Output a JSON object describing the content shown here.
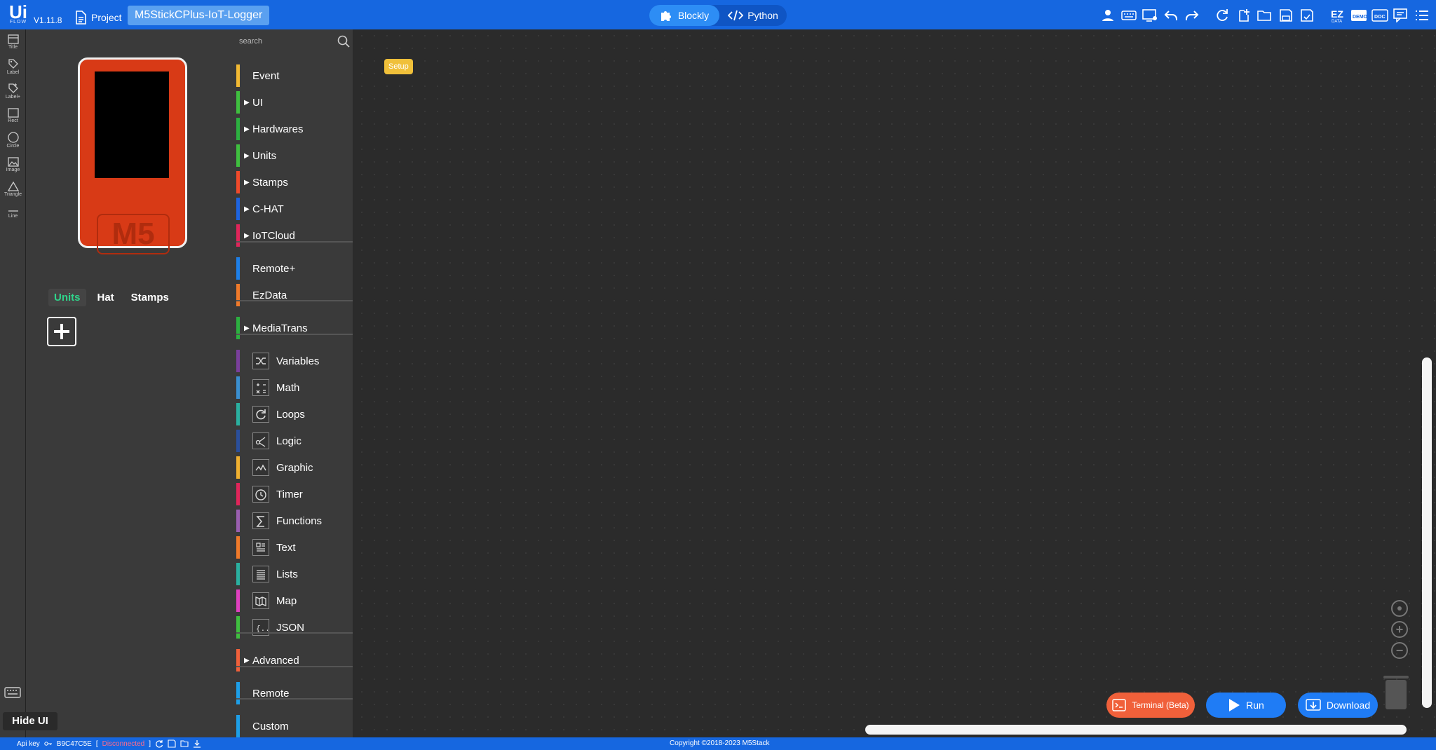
{
  "app": {
    "logo": "Ui",
    "logo_sub": "FLOW",
    "version": "V1.11.8",
    "project_label": "Project",
    "project_name": "M5StickCPlus-IoT-Logger"
  },
  "mode": {
    "blockly": "Blockly",
    "python": "Python"
  },
  "tools": [
    {
      "label": "Title",
      "icon": "title-icon"
    },
    {
      "label": "Label",
      "icon": "label-icon"
    },
    {
      "label": "Label+",
      "icon": "label-plus-icon"
    },
    {
      "label": "Rect",
      "icon": "rect-icon"
    },
    {
      "label": "Circle",
      "icon": "circle-icon"
    },
    {
      "label": "Image",
      "icon": "image-icon"
    },
    {
      "label": "Triangle",
      "icon": "triangle-icon"
    },
    {
      "label": "Line",
      "icon": "line-icon"
    }
  ],
  "device": {
    "logo_text": "M5"
  },
  "panel_tabs": [
    "Units",
    "Hat",
    "Stamps"
  ],
  "hide_ui": "Hide UI",
  "toolbox": {
    "search_placeholder": "search",
    "categories": [
      {
        "label": "Event",
        "color": "#f2b933",
        "arrow": false
      },
      {
        "label": "UI",
        "color": "#3fbf3f",
        "arrow": true
      },
      {
        "label": "Hardwares",
        "color": "#2cb040",
        "arrow": true
      },
      {
        "label": "Units",
        "color": "#3fbf3f",
        "arrow": true
      },
      {
        "label": "Stamps",
        "color": "#f04a2a",
        "arrow": true
      },
      {
        "label": "C-HAT",
        "color": "#1d64e0",
        "arrow": true
      },
      {
        "label": "IoTCloud",
        "color": "#e0255a",
        "arrow": true
      },
      {
        "label": "Remote+",
        "color": "#1d7fe8",
        "arrow": false
      },
      {
        "label": "EzData",
        "color": "#f07a2a",
        "arrow": false
      },
      {
        "label": "MediaTrans",
        "color": "#2cb040",
        "arrow": true
      },
      {
        "label": "Variables",
        "color": "#7a3f9c",
        "icon": "variables-icon"
      },
      {
        "label": "Math",
        "color": "#3a8fd0",
        "icon": "math-icon"
      },
      {
        "label": "Loops",
        "color": "#2ab0a0",
        "icon": "loops-icon"
      },
      {
        "label": "Logic",
        "color": "#2a4f9c",
        "icon": "logic-icon"
      },
      {
        "label": "Graphic",
        "color": "#f0b030",
        "icon": "graphic-icon"
      },
      {
        "label": "Timer",
        "color": "#e0255a",
        "icon": "timer-icon"
      },
      {
        "label": "Functions",
        "color": "#9a5fb0",
        "icon": "functions-icon"
      },
      {
        "label": "Text",
        "color": "#f07a2a",
        "icon": "text-icon"
      },
      {
        "label": "Lists",
        "color": "#2ab0a0",
        "icon": "lists-icon"
      },
      {
        "label": "Map",
        "color": "#e040c0",
        "icon": "map-icon"
      },
      {
        "label": "JSON",
        "color": "#3fbf3f",
        "icon": "json-icon"
      },
      {
        "label": "Advanced",
        "color": "#f0603a",
        "arrow": true
      },
      {
        "label": "Remote",
        "color": "#1d9fe8",
        "arrow": false
      },
      {
        "label": "Custom",
        "color": "#1d9fe8",
        "arrow": false
      }
    ]
  },
  "workspace": {
    "setup_block": "Setup"
  },
  "actions": {
    "terminal": "Terminal (Beta)",
    "run": "Run",
    "download": "Download"
  },
  "status": {
    "api_key_label": "Api key",
    "api_key": "B9C47C5E",
    "connection": "Disconnected",
    "copyright": "Copyright ©2018-2023 M5Stack"
  }
}
